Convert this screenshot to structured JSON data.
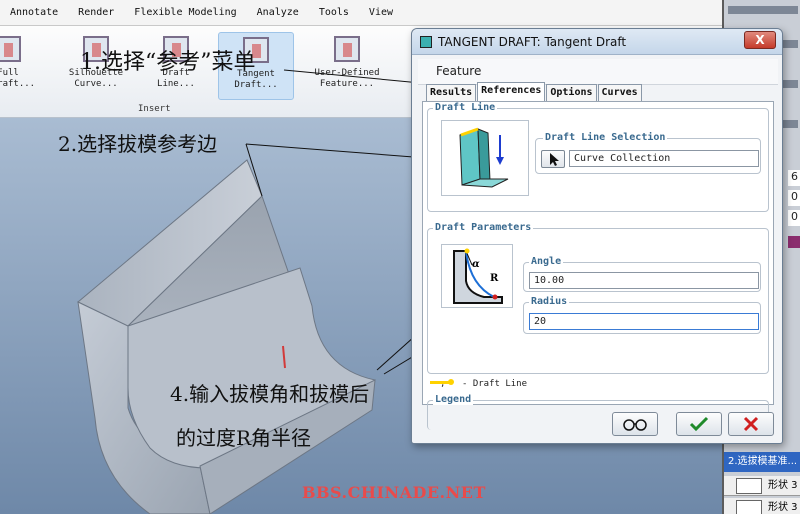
{
  "menu": {
    "items": [
      "Annotate",
      "Render",
      "Flexible Modeling",
      "Analyze",
      "Tools",
      "View"
    ]
  },
  "ribbon": {
    "buttons": [
      {
        "line1": "Full",
        "line2": "n Draft..."
      },
      {
        "line1": "Silhouette",
        "line2": "Curve..."
      },
      {
        "line1": "Draft",
        "line2": "Line..."
      },
      {
        "line1": "Tangent",
        "line2": "Draft..."
      },
      {
        "line1": "User-Defined",
        "line2": "Feature..."
      }
    ],
    "group_label": "Insert"
  },
  "annotations": {
    "step1": "1.选择“参考”菜单",
    "step2": "2.选择拔模参考边",
    "step4_line1": "4.输入拔模角和拔模后",
    "step4_line2": "的过度R角半径"
  },
  "watermark": "BBS.CHINADE.NET",
  "dialog": {
    "title": "TANGENT DRAFT: Tangent Draft",
    "feature_label": "Feature",
    "tabs": [
      "Results",
      "References",
      "Options",
      "Curves"
    ],
    "active_tab": "References",
    "draft_line": {
      "group_title": "Draft Line",
      "selection_title": "Draft Line Selection",
      "selection_value": "Curve Collection"
    },
    "draft_parameters": {
      "group_title": "Draft Parameters",
      "angle_label": "Angle",
      "angle_value": "10.00",
      "radius_label": "Radius",
      "radius_value": "20",
      "diagram_alpha": "α",
      "diagram_r": "R"
    },
    "legend": {
      "title": "Legend",
      "separator": ",",
      "text": "- Draft Line"
    },
    "close_glyph": "X"
  },
  "right_panel": {
    "numbers": [
      "6",
      "0",
      "0"
    ],
    "highlight_text": "2.选拔模基准...",
    "rows": [
      {
        "label": "形状 3"
      },
      {
        "label": "形状 3"
      }
    ]
  },
  "colors": {
    "draft_line": "#ffd200",
    "ok_check": "#1f8a2a",
    "cancel_x": "#d11f1f",
    "tab_accent": "#3a6a8f"
  }
}
